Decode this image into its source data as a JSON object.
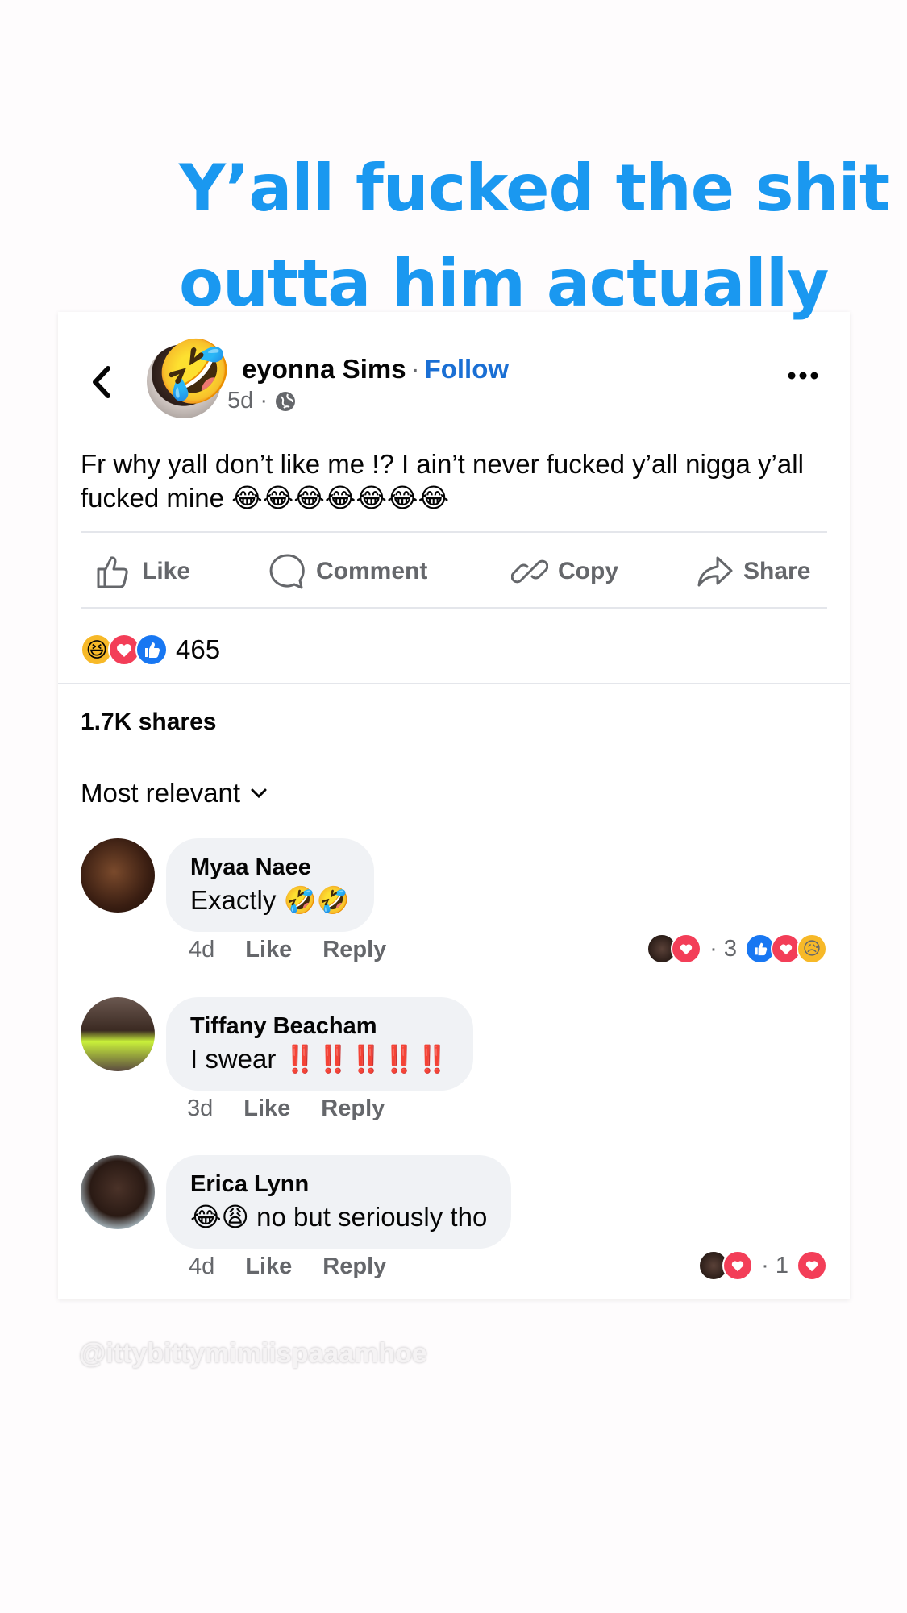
{
  "caption": "Y’all fucked the shit\noutta him actually",
  "post": {
    "author": "eyonna Sims",
    "separator": "·",
    "follow_label": "Follow",
    "time": "5d ·",
    "text": "Fr why yall don’t like me !? I ain’t never fucked y’all nigga y’all fucked mine 😂😂😂😂😂😂😂",
    "overlay_emoji": "🤣"
  },
  "actions": {
    "like": "Like",
    "comment": "Comment",
    "copy": "Copy",
    "share": "Share"
  },
  "reactions": {
    "icons": [
      "haha",
      "love",
      "like"
    ],
    "count": "465"
  },
  "shares": "1.7K shares",
  "sort_label": "Most relevant",
  "comments": [
    {
      "name": "Myaa Naee",
      "text": "Exactly 🤣🤣",
      "time": "4d",
      "like": "Like",
      "reply": "Reply",
      "reaction_count": "· 3",
      "reaction_icons": [
        "like",
        "love",
        "sad"
      ]
    },
    {
      "name": "Tiffany Beacham",
      "text": "I swear ‼️‼️‼️‼️‼️",
      "time": "3d",
      "like": "Like",
      "reply": "Reply"
    },
    {
      "name": "Erica Lynn",
      "text": "😂😩 no but seriously tho",
      "time": "4d",
      "like": "Like",
      "reply": "Reply",
      "reaction_count": "· 1",
      "reaction_icons": [
        "love"
      ]
    }
  ],
  "watermark": "@ittybittymimiispaaamhoe",
  "colors": {
    "caption": "#1a98f0",
    "follow": "#1a6fd4",
    "muted": "#65676b",
    "bubble": "#f0f2f5",
    "like_blue": "#1877f2",
    "love_red": "#f33e58",
    "haha_yellow": "#f7b928"
  }
}
